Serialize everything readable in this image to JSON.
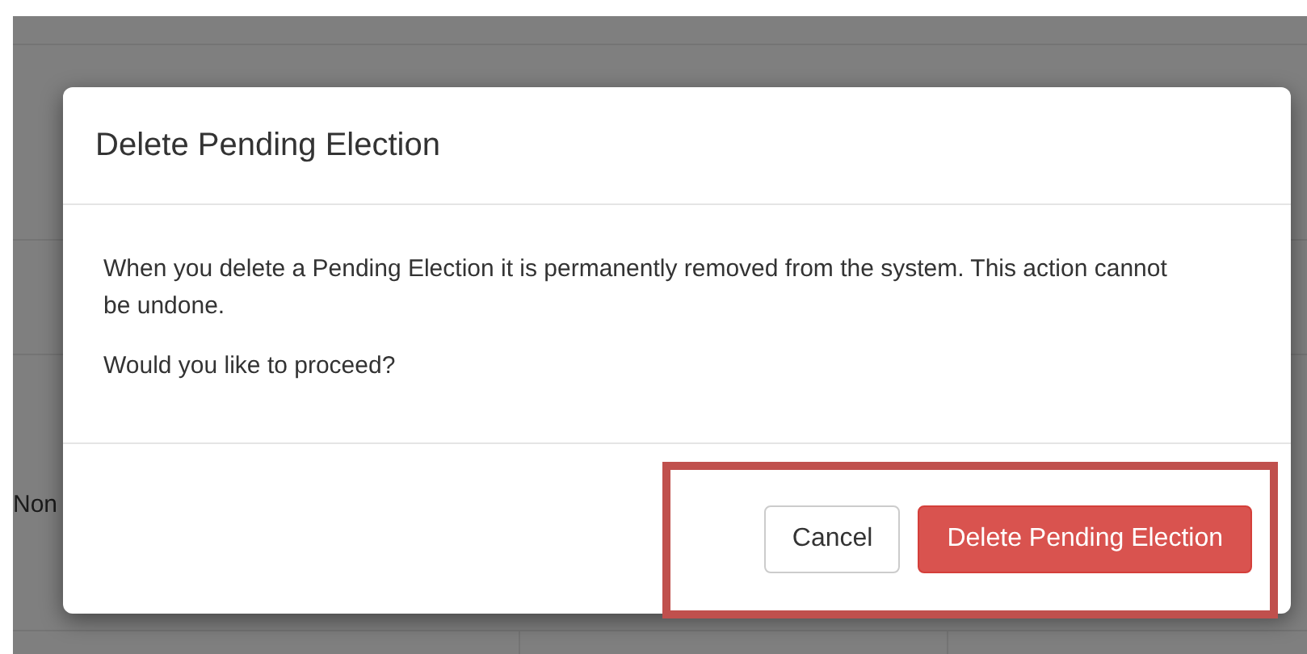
{
  "background": {
    "row_text": "Non"
  },
  "dialog": {
    "title": "Delete Pending Election",
    "paragraphs": [
      "When you delete a Pending Election it is permanently removed from the system. This action cannot be undone.",
      "Would you like to proceed?"
    ],
    "buttons": [
      {
        "label": "Cancel",
        "kind": "default"
      },
      {
        "label": "Delete Pending Election",
        "kind": "danger"
      }
    ],
    "highlight_buttons": true
  }
}
